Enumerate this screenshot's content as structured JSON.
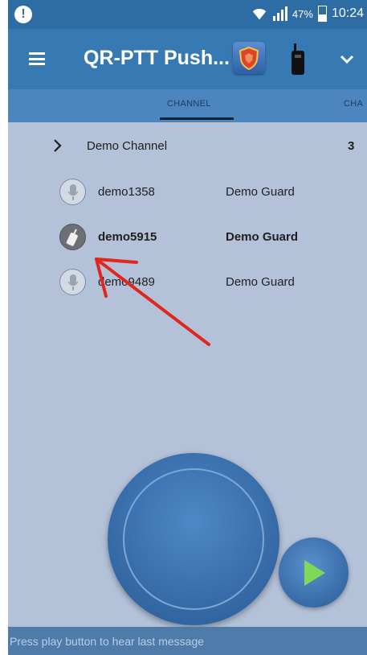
{
  "status_bar": {
    "battery_percent": "47%",
    "time": "10:24",
    "alert_glyph": "!",
    "icons": [
      "alert-icon",
      "wifi-icon",
      "signal-icon",
      "battery-icon"
    ]
  },
  "app_bar": {
    "title": "QR-PTT Push...",
    "icons": [
      "menu-icon",
      "shield-app-icon",
      "radio-icon",
      "chevron-down-icon"
    ]
  },
  "tabs": [
    {
      "label": "CHANNEL",
      "selected": true
    },
    {
      "label": "CHA",
      "selected": false
    }
  ],
  "channel_group": {
    "name": "Demo Channel",
    "count": "3",
    "members": [
      {
        "name": "demo1358",
        "role": "Demo Guard",
        "icon": "microphone-icon",
        "highlighted": false
      },
      {
        "name": "demo5915",
        "role": "Demo Guard",
        "icon": "walkie-talkie-icon",
        "highlighted": true
      },
      {
        "name": "demo9489",
        "role": "Demo Guard",
        "icon": "microphone-icon",
        "highlighted": false
      }
    ]
  },
  "controls": {
    "ptt_button": "push-to-talk",
    "play_button": "play-icon"
  },
  "footer": {
    "message": "Press play button to hear last message"
  },
  "colors": {
    "status_bar": "#2e6da4",
    "app_bar": "#3779b2",
    "tab_bar": "#4d86bf",
    "background": "#b4c2d9",
    "play_triangle": "#7fd957",
    "annotation_arrow": "#e0261f"
  }
}
